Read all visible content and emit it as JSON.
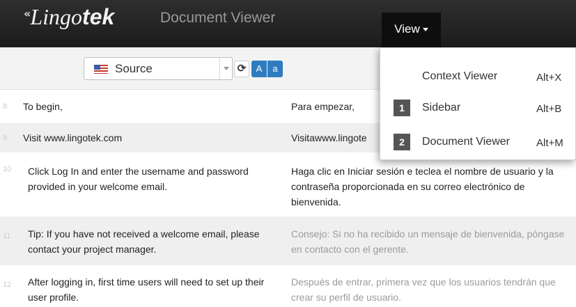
{
  "brand": {
    "logo_mark": "«",
    "logo_light": "Lingo",
    "logo_bold": "tek"
  },
  "header": {
    "title": "Document Viewer",
    "view_label": "View"
  },
  "toolbar": {
    "language_select": {
      "value": "Source"
    },
    "refresh_icon": "refresh-icon",
    "font_large_label": "A",
    "font_small_label": "a"
  },
  "segments": [
    {
      "num": "8",
      "source": "To begin,",
      "target": "Para empezar,"
    },
    {
      "num": "9",
      "source": "Visit www.lingotek.com",
      "target": "Visitawww.lingote"
    },
    {
      "num": "10",
      "source": "Click Log In and enter the username and password provided in your welcome email.",
      "target": "Haga clic en Iniciar sesión e teclea el nombre de usuario y la contraseña proporcionada en su correo electrónico de bienvenida."
    },
    {
      "num": "11",
      "source": "Tip: If you have not received a welcome email, please contact your project manager.",
      "target": "Consejo: Si no ha recibido un mensaje de bienvenida, póngase en contacto con el gerente."
    },
    {
      "num": "12",
      "source": "After logging in, first time users will need to set up their user profile.",
      "target": "Después de entrar, primera vez que los usuarios tendrán que crear su perfil de usuario."
    }
  ],
  "view_menu": {
    "items": [
      {
        "badge": "",
        "label": "Context Viewer",
        "shortcut": "Alt+X"
      },
      {
        "badge": "1",
        "label": "Sidebar",
        "shortcut": "Alt+B"
      },
      {
        "badge": "2",
        "label": "Document Viewer",
        "shortcut": "Alt+M"
      }
    ]
  },
  "colors": {
    "header_bg": "#1c1c1c",
    "accent_blue": "#2f7dc0",
    "row_alt_bg": "#efefef",
    "badge_bg": "#555555"
  }
}
